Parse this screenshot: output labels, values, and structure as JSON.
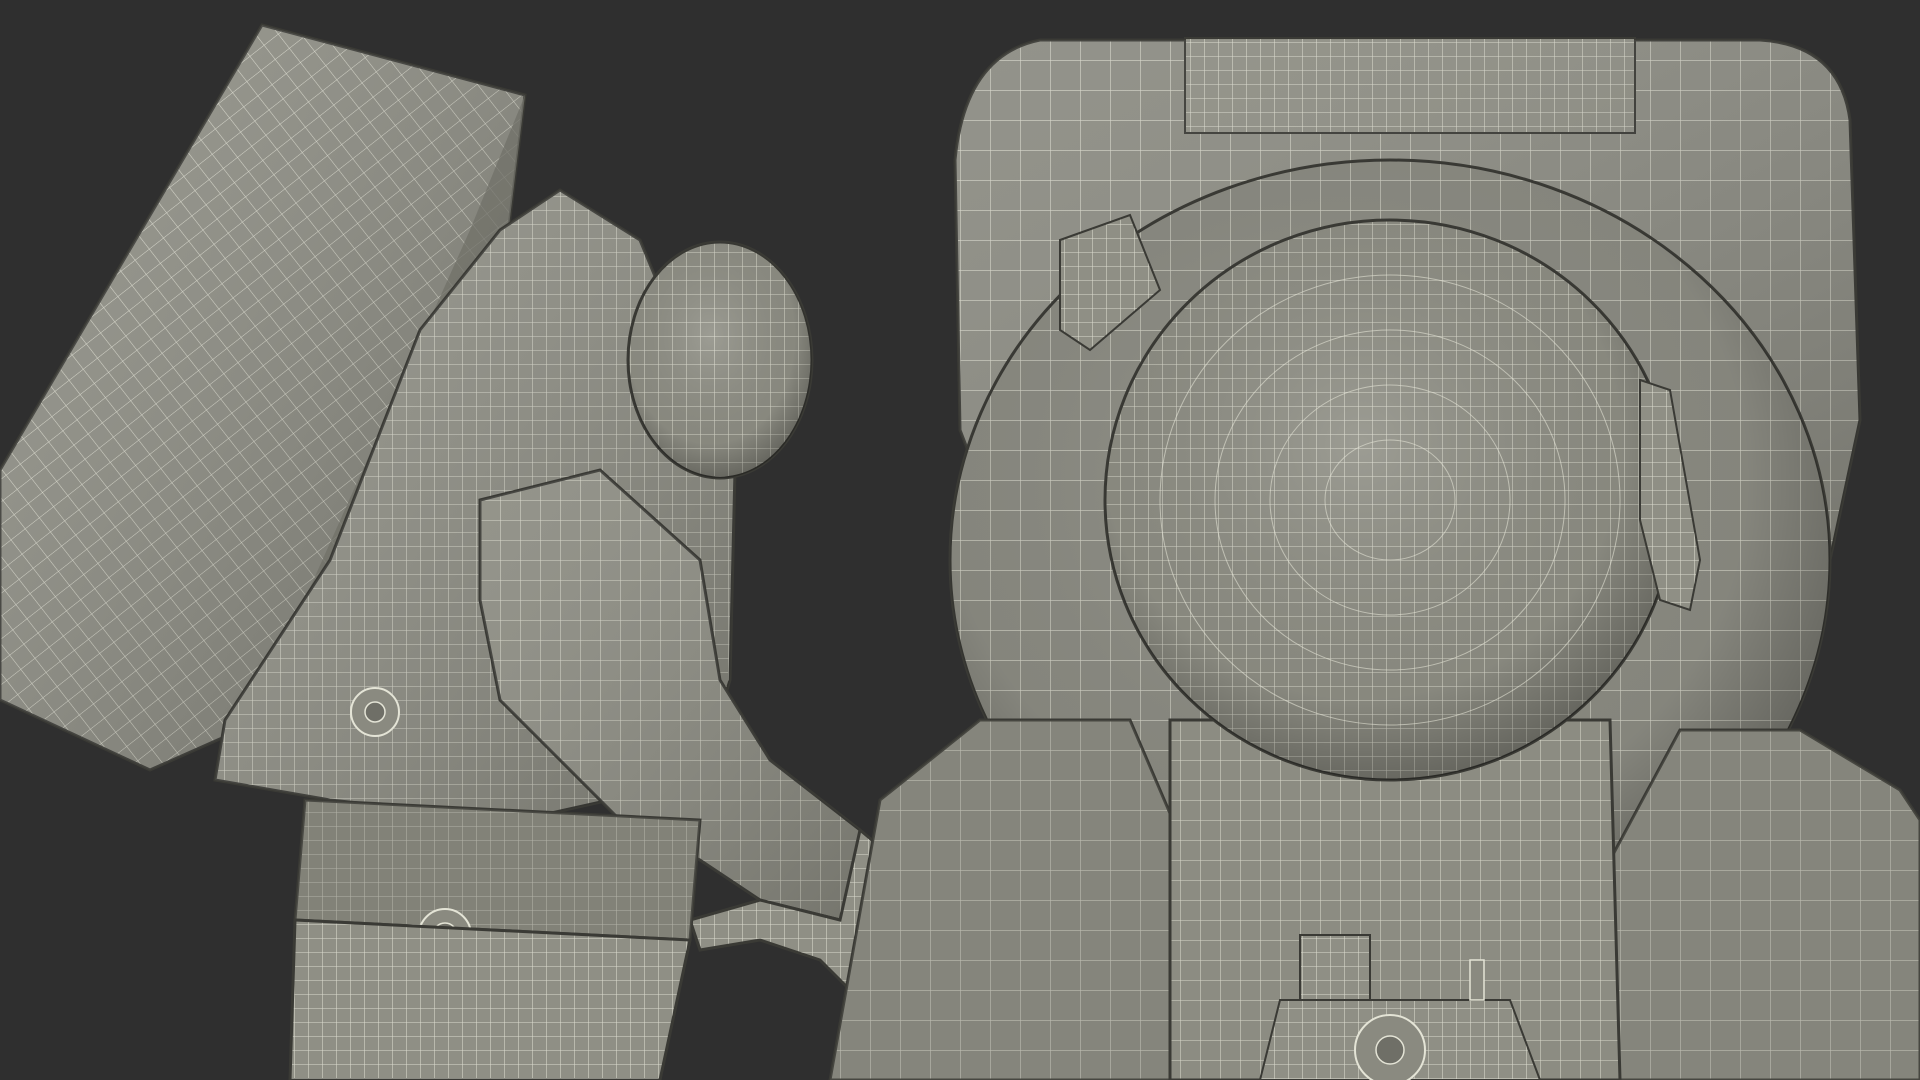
{
  "scene": {
    "background_color": "#2f2f2f",
    "mesh_fill_color": "#8f8f85",
    "mesh_shade_color": "#6f6f67",
    "mesh_highlight_color": "#a8a89d",
    "wire_color": "#e4e4d6",
    "subjects": [
      "astronaut-side-view-wireframe",
      "astronaut-top-view-wireframe"
    ]
  }
}
